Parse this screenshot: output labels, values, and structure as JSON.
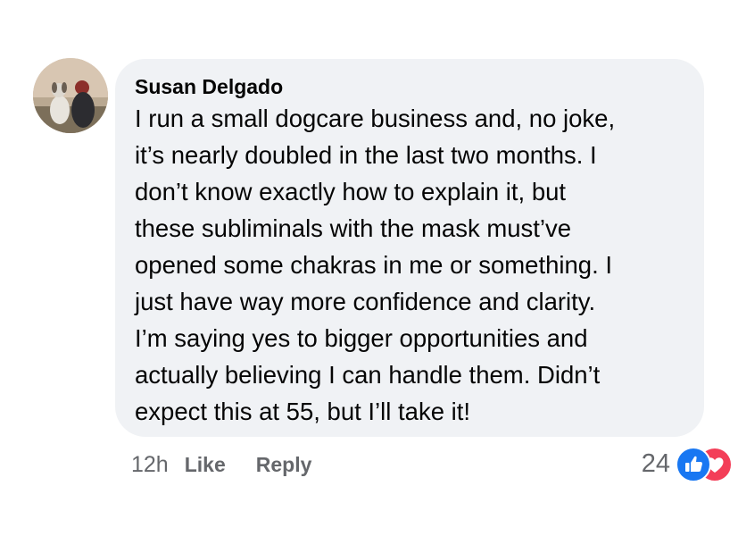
{
  "comment": {
    "author": "Susan Delgado",
    "lines": [
      "I run a small dogcare business and, no joke,",
      "it’s nearly doubled in the last two months. I",
      "don’t know exactly how to explain it, but",
      "these subliminals with the mask must’ve",
      "opened some chakras in me or something. I",
      "just have way more confidence and clarity.",
      "I’m saying yes to bigger opportunities and",
      "actually believing I can handle them. Didn’t",
      "expect this at 55, but I’ll take it!"
    ],
    "timestamp": "12h",
    "like_label": "Like",
    "reply_label": "Reply",
    "reaction_count": "24",
    "reaction_icons": [
      "like-icon",
      "love-icon"
    ]
  },
  "colors": {
    "bubble": "#f0f2f5",
    "text": "#050505",
    "muted": "#65676b",
    "like": "#1877f2",
    "love": "#f33e58"
  }
}
